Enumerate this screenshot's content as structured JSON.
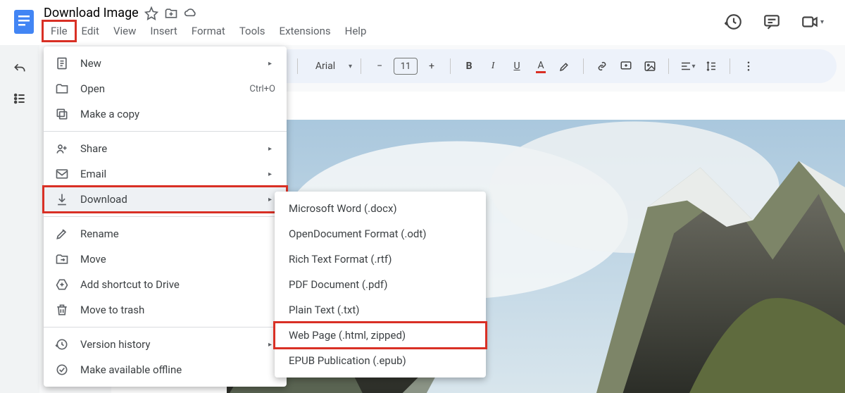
{
  "document": {
    "title": "Download Image"
  },
  "menubar": {
    "items": [
      "File",
      "Edit",
      "View",
      "Insert",
      "Format",
      "Tools",
      "Extensions",
      "Help"
    ]
  },
  "toolbar": {
    "font": "Arial",
    "fontSize": "11"
  },
  "fileMenu": {
    "new": "New",
    "open": "Open",
    "openShortcut": "Ctrl+O",
    "copy": "Make a copy",
    "share": "Share",
    "email": "Email",
    "download": "Download",
    "rename": "Rename",
    "move": "Move",
    "shortcut": "Add shortcut to Drive",
    "trash": "Move to trash",
    "version": "Version history",
    "offline": "Make available offline"
  },
  "downloadMenu": {
    "items": [
      "Microsoft Word (.docx)",
      "OpenDocument Format (.odt)",
      "Rich Text Format (.rtf)",
      "PDF Document (.pdf)",
      "Plain Text (.txt)",
      "Web Page (.html, zipped)",
      "EPUB Publication (.epub)"
    ]
  }
}
